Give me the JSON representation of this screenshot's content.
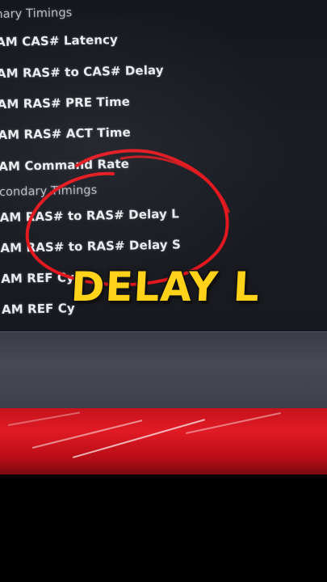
{
  "bios": {
    "rows": [
      "nary Timings",
      "AM CAS# Latency",
      "AM RAS# to CAS# Delay",
      "AM RAS# PRE Time",
      "AM RAS# ACT Time",
      "AM Command Rate",
      "condary Timings",
      "AM RAS# to RAS# Delay L",
      "AM RAS# to RAS# Delay S",
      "AM REF Cy",
      "AM REF Cy"
    ]
  },
  "caption": {
    "text": "DELAY L"
  },
  "colors": {
    "caption_fill": "#ffd21a",
    "annotation_circle": "#e3161d",
    "deck_red": "#d5141e",
    "screen_bg": "#1a1c22"
  },
  "annotation": {
    "type": "hand-drawn-circle",
    "target": "AM RAS# to RAS# Delay L"
  }
}
